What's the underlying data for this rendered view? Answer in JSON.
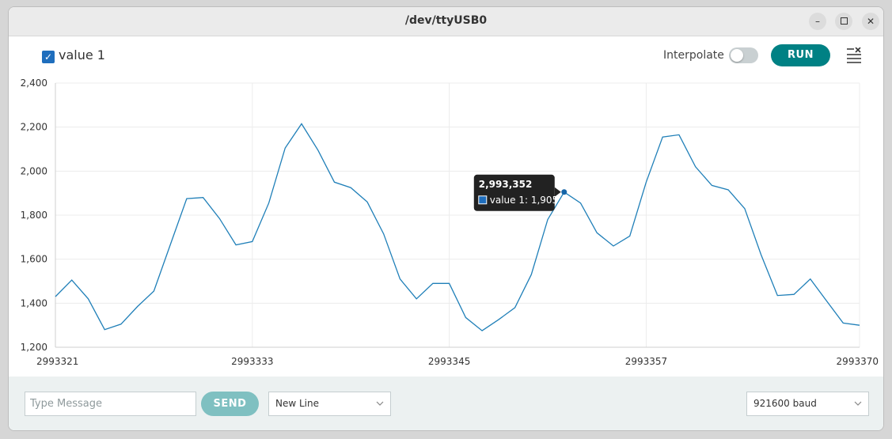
{
  "window": {
    "title": "/dev/ttyUSB0"
  },
  "toolbar": {
    "legend_label": "value 1",
    "legend_checked": true,
    "interpolate_label": "Interpolate",
    "interpolate_on": false,
    "run_label": "RUN"
  },
  "tooltip": {
    "title": "2,993,352",
    "entry": "value 1: 1,905"
  },
  "footer": {
    "message_placeholder": "Type Message",
    "send_label": "SEND",
    "line_ending": "New Line",
    "baud": "921600 baud"
  },
  "colors": {
    "line": "#1f7fb8",
    "accent": "#008184",
    "send_disabled": "#7fc0c1",
    "checkbox": "#1f6ebd"
  },
  "chart_data": {
    "type": "line",
    "series": [
      {
        "name": "value 1",
        "x": [
          2993321,
          2993322,
          2993323,
          2993324,
          2993325,
          2993326,
          2993327,
          2993328,
          2993329,
          2993330,
          2993331,
          2993332,
          2993333,
          2993334,
          2993335,
          2993336,
          2993337,
          2993338,
          2993339,
          2993340,
          2993341,
          2993342,
          2993343,
          2993344,
          2993345,
          2993346,
          2993347,
          2993348,
          2993349,
          2993350,
          2993351,
          2993352,
          2993353,
          2993354,
          2993355,
          2993356,
          2993357,
          2993358,
          2993359,
          2993360,
          2993361,
          2993362,
          2993363,
          2993364,
          2993365,
          2993366,
          2993367,
          2993368,
          2993369,
          2993370
        ],
        "values": [
          1430,
          1505,
          1420,
          1280,
          1305,
          1385,
          1455,
          1665,
          1875,
          1880,
          1785,
          1665,
          1680,
          1855,
          2105,
          2215,
          2095,
          1950,
          1925,
          1860,
          1715,
          1510,
          1420,
          1490,
          1490,
          1335,
          1275,
          1325,
          1380,
          1530,
          1780,
          1905,
          1855,
          1720,
          1660,
          1705,
          1950,
          2155,
          2165,
          2020,
          1935,
          1915,
          1830,
          1620,
          1435,
          1440,
          1510,
          1410,
          1310,
          1300
        ]
      }
    ],
    "xlim": [
      2993321,
      2993370
    ],
    "ylim": [
      1200,
      2400
    ],
    "yticks": [
      1200,
      1400,
      1600,
      1800,
      2000,
      2200,
      2400
    ],
    "ytick_labels": [
      "1,200",
      "1,400",
      "1,600",
      "1,800",
      "2,000",
      "2,200",
      "2,400"
    ],
    "xticks": [
      2993321,
      2993333,
      2993345,
      2993357,
      2993370
    ],
    "xtick_labels": [
      "2993321",
      "2993333",
      "2993345",
      "2993357",
      "2993370"
    ],
    "highlight_x": 2993352,
    "grid": true,
    "title": "",
    "xlabel": "",
    "ylabel": ""
  }
}
